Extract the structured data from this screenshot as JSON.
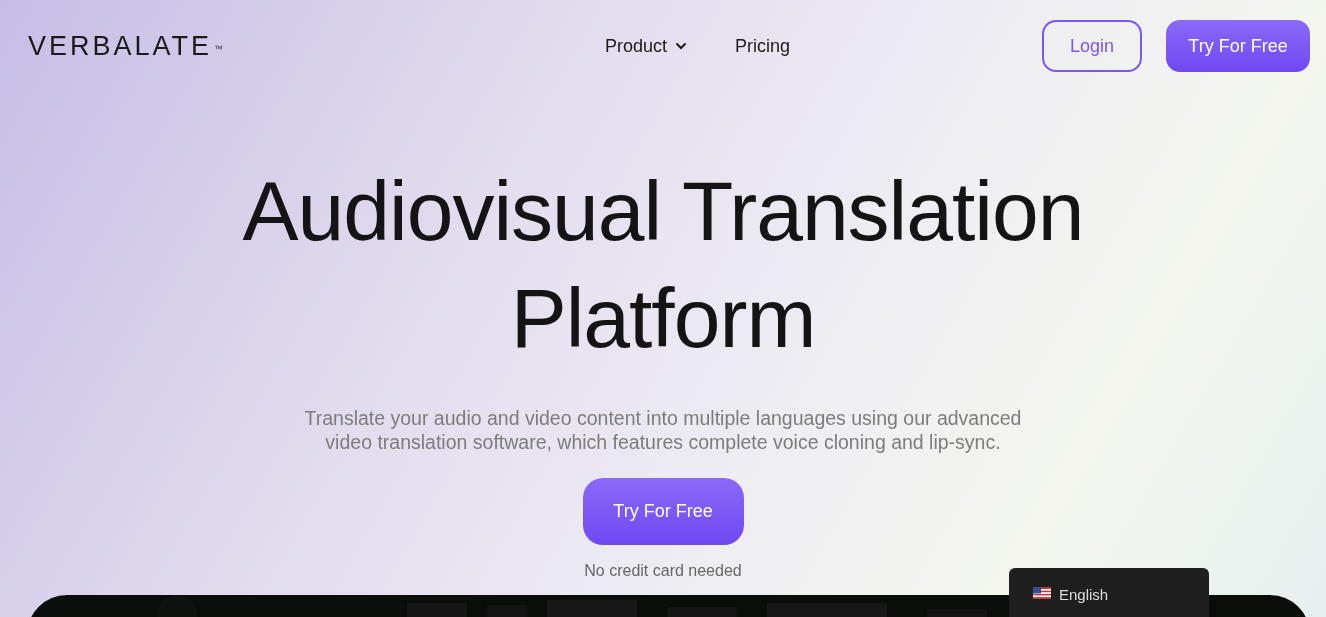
{
  "logo": {
    "name": "VERBALATE",
    "mark": "™"
  },
  "nav": [
    {
      "label": "Product",
      "kind": "dropdown"
    },
    {
      "label": "Pricing",
      "kind": "link"
    }
  ],
  "actions": [
    {
      "label": "Login",
      "kind": "outline"
    },
    {
      "label": "Try For Free",
      "kind": "solid"
    }
  ],
  "hero": {
    "title_lines": [
      "Audiovisual Translation",
      "Platform"
    ],
    "subtitle_lines": [
      "Translate your audio and video content into multiple languages using our advanced",
      "video translation software, which features complete voice cloning and lip-sync."
    ],
    "cta": "Try For Free",
    "note": "No credit card needed"
  },
  "language": {
    "label": "English"
  }
}
